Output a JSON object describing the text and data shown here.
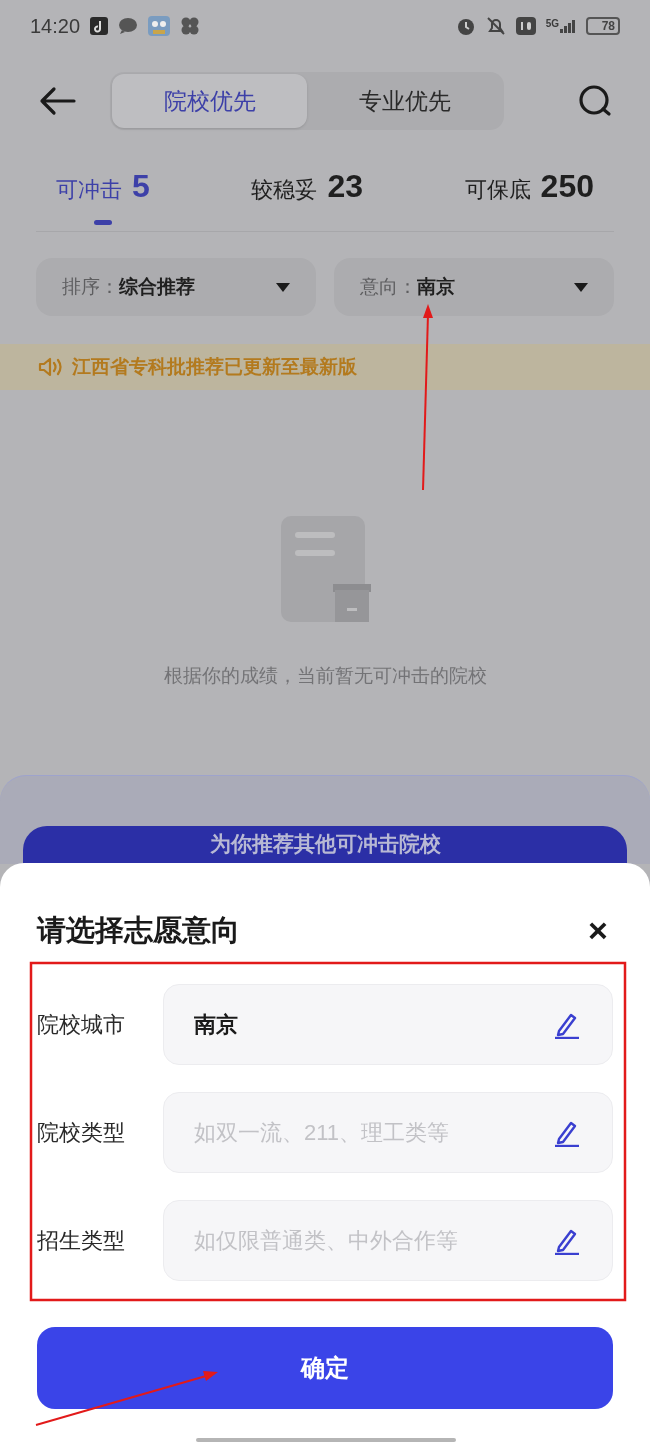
{
  "status_bar": {
    "time": "14:20",
    "network": "5G",
    "battery": "78"
  },
  "mode_tabs": [
    {
      "label": "院校优先",
      "selected": true
    },
    {
      "label": "专业优先",
      "selected": false
    }
  ],
  "stat_tabs": [
    {
      "label": "可冲击",
      "count": "5",
      "selected": true
    },
    {
      "label": "较稳妥",
      "count": "23",
      "selected": false
    },
    {
      "label": "可保底",
      "count": "250",
      "selected": false
    }
  ],
  "filters": [
    {
      "label": "排序：",
      "value": "综合推荐"
    },
    {
      "label": "意向：",
      "value": "南京"
    }
  ],
  "notice": "江西省专科批推荐已更新至最新版",
  "empty_state": "根据你的成绩，当前暂无可冲击的院校",
  "recommend_button": "为你推荐其他可冲击院校",
  "sheet": {
    "title": "请选择志愿意向",
    "close": "×",
    "fields": [
      {
        "label": "院校城市",
        "value": "南京"
      },
      {
        "label": "院校类型",
        "placeholder": "如双一流、211、理工类等"
      },
      {
        "label": "招生类型",
        "placeholder": "如仅限普通类、中外合作等"
      }
    ],
    "confirm": "确定"
  }
}
